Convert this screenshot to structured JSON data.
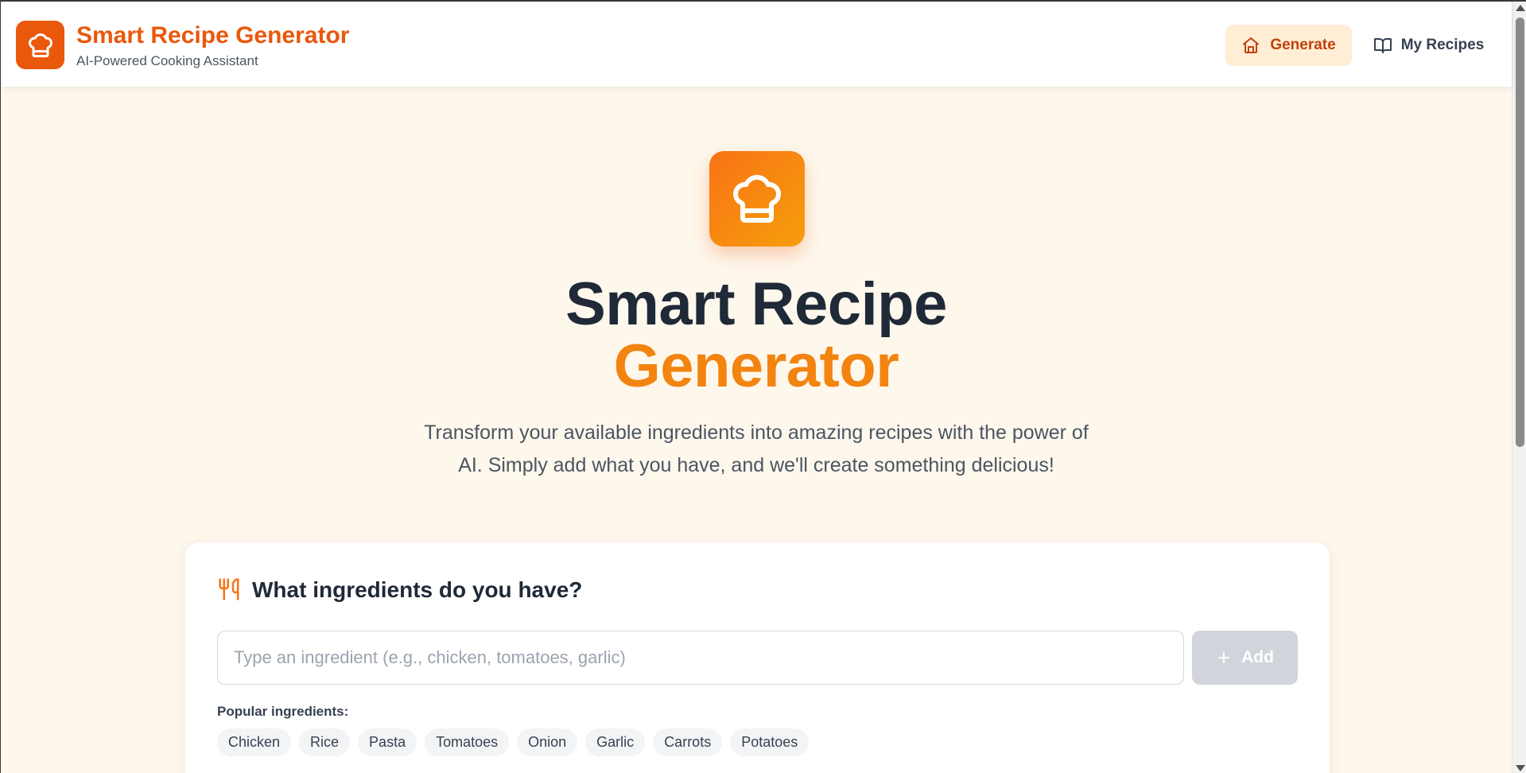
{
  "header": {
    "title": "Smart Recipe Generator",
    "subtitle": "AI-Powered Cooking Assistant",
    "nav": {
      "generate_label": "Generate",
      "my_recipes_label": "My Recipes"
    }
  },
  "hero": {
    "title_line1": "Smart Recipe",
    "title_line2": "Generator",
    "description": "Transform your available ingredients into amazing recipes with the power of AI. Simply add what you have, and we'll create something delicious!"
  },
  "ingredients_card": {
    "title": "What ingredients do you have?",
    "input": {
      "placeholder": "Type an ingredient (e.g., chicken, tomatoes, garlic)",
      "value": ""
    },
    "add_label": "Add",
    "popular_label": "Popular ingredients:",
    "popular": [
      "Chicken",
      "Rice",
      "Pasta",
      "Tomatoes",
      "Onion",
      "Garlic",
      "Carrots",
      "Potatoes"
    ]
  },
  "icons": {
    "brand": "chef-hat-icon",
    "generate": "home-icon",
    "my_recipes": "book-open-icon",
    "card": "utensils-icon",
    "add": "plus-icon"
  },
  "colors": {
    "brand": "#ea580c",
    "accent": "#f2840f",
    "background": "#fef7ec",
    "nav_active_bg": "#ffedd5",
    "add_disabled": "#d1d5db"
  }
}
